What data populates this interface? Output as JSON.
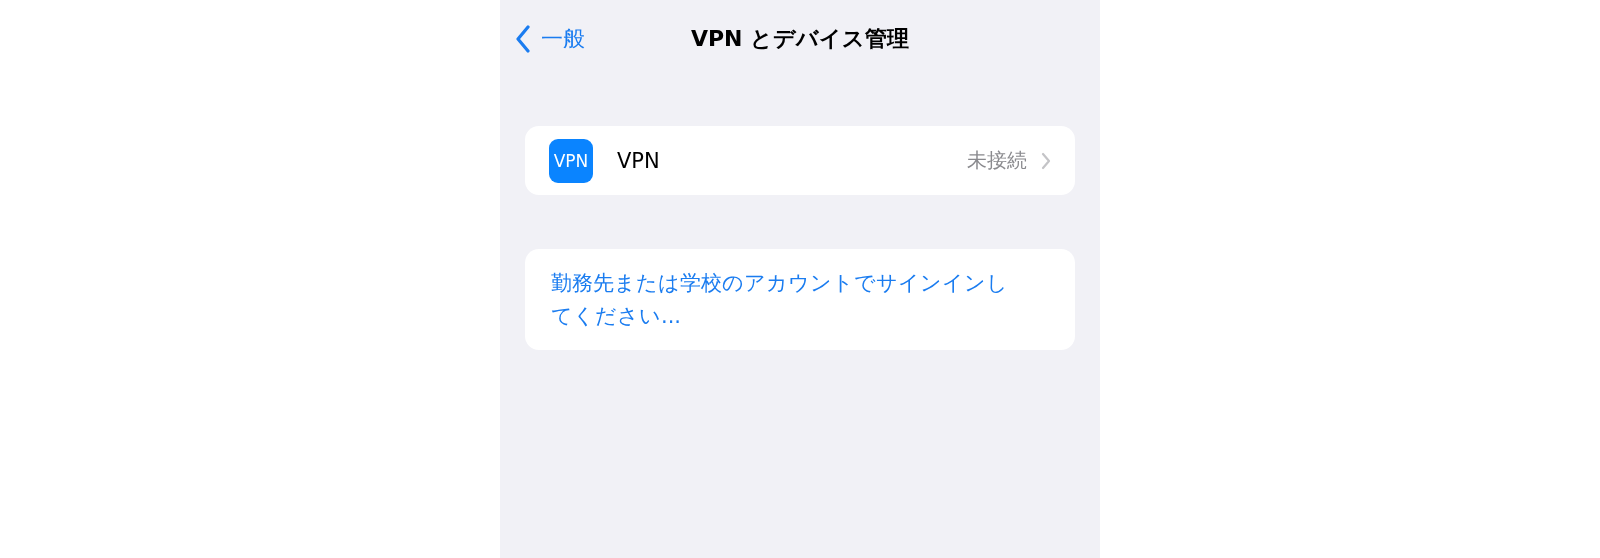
{
  "nav": {
    "back_label": "一般",
    "title": "VPN とデバイス管理"
  },
  "vpn_row": {
    "icon_text": "VPN",
    "label": "VPN",
    "status": "未接続"
  },
  "account_link": "勤務先または学校のアカウントでサインインしてください..."
}
